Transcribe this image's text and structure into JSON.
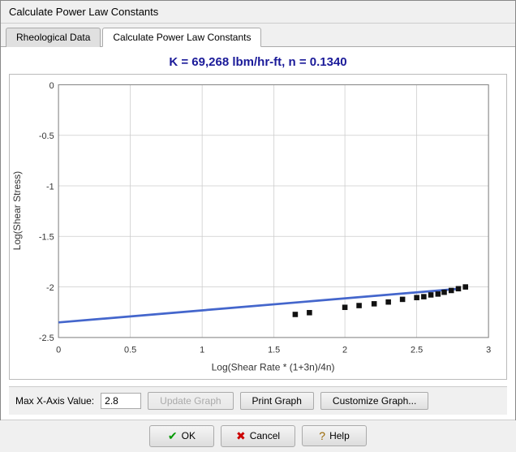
{
  "window": {
    "title": "Calculate Power Law Constants"
  },
  "tabs": [
    {
      "label": "Rheological Data",
      "active": false
    },
    {
      "label": "Calculate Power Law Constants",
      "active": true
    }
  ],
  "graph": {
    "title": "K = 69,268 lbm/hr-ft, n = 0.1340",
    "y_axis_label": "Log(Shear Stress)",
    "x_axis_label": "Log(Shear Rate * (1+3n)/4n)",
    "y_min": -2.5,
    "y_max": 0,
    "x_min": 0,
    "x_max": 3
  },
  "controls": {
    "max_x_label": "Max X-Axis Value:",
    "max_x_value": "2.8",
    "update_graph_label": "Update Graph",
    "print_graph_label": "Print Graph",
    "customize_graph_label": "Customize Graph..."
  },
  "footer": {
    "ok_label": "OK",
    "cancel_label": "Cancel",
    "help_label": "Help"
  }
}
